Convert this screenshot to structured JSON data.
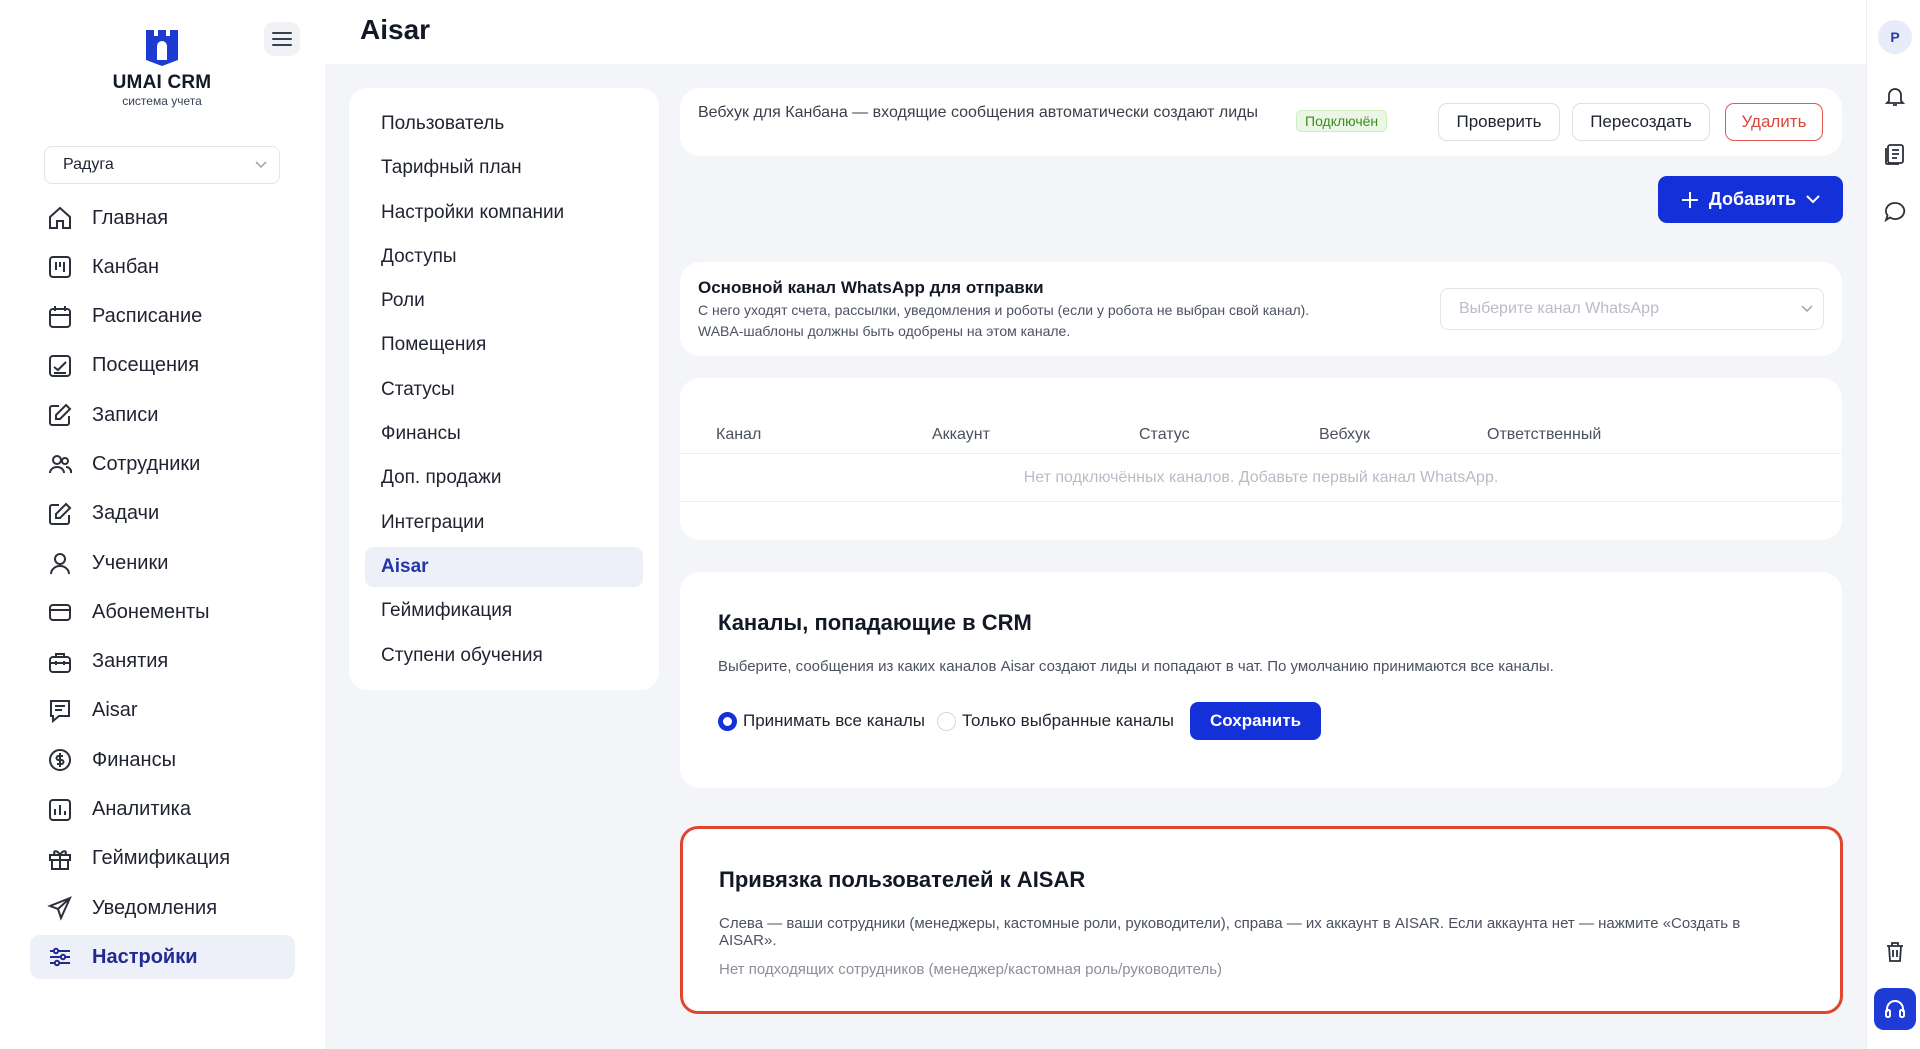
{
  "brand": {
    "name": "UMAI CRM",
    "tagline": "система учета",
    "color": "#1d3bd1"
  },
  "company_select": {
    "value": "Радуга"
  },
  "nav": {
    "items": [
      {
        "label": "Главная",
        "icon": "home-icon"
      },
      {
        "label": "Канбан",
        "icon": "kanban-icon"
      },
      {
        "label": "Расписание",
        "icon": "calendar-icon"
      },
      {
        "label": "Посещения",
        "icon": "attendance-icon"
      },
      {
        "label": "Записи",
        "icon": "edit-icon"
      },
      {
        "label": "Сотрудники",
        "icon": "users-icon"
      },
      {
        "label": "Задачи",
        "icon": "tasks-icon"
      },
      {
        "label": "Ученики",
        "icon": "user-icon"
      },
      {
        "label": "Абонементы",
        "icon": "card-icon"
      },
      {
        "label": "Занятия",
        "icon": "briefcase-icon"
      },
      {
        "label": "Aisar",
        "icon": "chat-icon"
      },
      {
        "label": "Финансы",
        "icon": "dollar-icon"
      },
      {
        "label": "Аналитика",
        "icon": "chart-icon"
      },
      {
        "label": "Геймификация",
        "icon": "gift-icon"
      },
      {
        "label": "Уведомления",
        "icon": "send-icon"
      },
      {
        "label": "Настройки",
        "icon": "sliders-icon",
        "active": true
      }
    ]
  },
  "header": {
    "title": "Aisar"
  },
  "rail": {
    "avatar_letter": "P"
  },
  "settings_menu": {
    "items": [
      {
        "label": "Пользователь"
      },
      {
        "label": "Тарифный план"
      },
      {
        "label": "Настройки компании"
      },
      {
        "label": "Доступы"
      },
      {
        "label": "Роли"
      },
      {
        "label": "Помещения"
      },
      {
        "label": "Статусы"
      },
      {
        "label": "Финансы"
      },
      {
        "label": "Доп. продажи"
      },
      {
        "label": "Интеграции"
      },
      {
        "label": "Aisar",
        "active": true
      },
      {
        "label": "Геймификация"
      },
      {
        "label": "Ступени обучения"
      }
    ]
  },
  "webhook": {
    "text": "Вебхук для Канбана — входящие сообщения автоматически создают лиды",
    "status": "Подключён",
    "check_label": "Проверить",
    "recreate_label": "Пересоздать",
    "delete_label": "Удалить"
  },
  "add_button": {
    "label": "Добавить"
  },
  "whatsapp": {
    "title": "Основной канал WhatsApp для отправки",
    "desc_line1": "С него уходят счета, рассылки, уведомления и роботы (если у робота не выбран свой канал).",
    "desc_line2": "WABA-шаблоны должны быть одобрены на этом канале.",
    "select_placeholder": "Выберите канал WhatsApp"
  },
  "channels_table": {
    "columns": [
      "Канал",
      "Аккаунт",
      "Статус",
      "Вебхук",
      "Ответственный"
    ],
    "empty_text": "Нет подключённых каналов. Добавьте первый канал WhatsApp."
  },
  "crm_channels": {
    "title": "Каналы, попадающие в CRM",
    "desc": "Выберите, сообщения из каких каналов Aisar создают лиды и попадают в чат. По умолчанию принимаются все каналы.",
    "option_all": "Принимать все каналы",
    "option_selected": "Только выбранные каналы",
    "save_label": "Сохранить"
  },
  "user_binding": {
    "title": "Привязка пользователей к AISAR",
    "desc": "Слева — ваши сотрудники (менеджеры, кастомные роли, руководители), справа — их аккаунт в AISAR. Если аккаунта нет — нажмите «Создать в AISAR».",
    "empty_text": "Нет подходящих сотрудников (менеджер/кастомная роль/руководитель)"
  }
}
